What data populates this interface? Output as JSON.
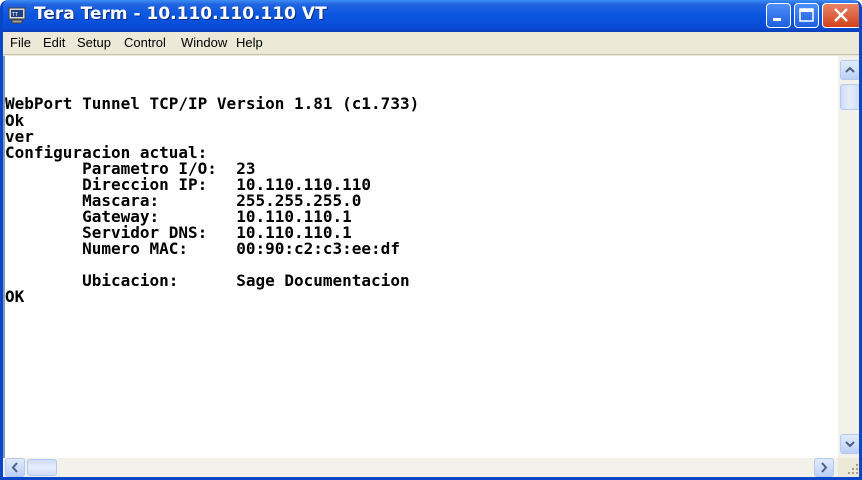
{
  "window": {
    "title": "Tera Term - 10.110.110.110 VT",
    "colors": {
      "titlebar": "#0a55e0",
      "close": "#d2431d",
      "terminal_bg": "#ffffff",
      "terminal_fg": "#000000"
    }
  },
  "menu": {
    "items": [
      "File",
      "Edit",
      "Setup",
      "Control",
      "Window",
      "Help"
    ]
  },
  "terminal": {
    "lines": [
      "WebPort Tunnel TCP/IP Version 1.81 (c1.733)",
      "Ok",
      "ver",
      "Configuracion actual:",
      "        Parametro I/O:  23",
      "        Direccion IP:   10.110.110.110",
      "        Mascara:        255.255.255.0",
      "        Gateway:        10.110.110.1",
      "        Servidor DNS:   10.110.110.1",
      "        Numero MAC:     00:90:c2:c3:ee:df",
      "",
      "        Ubicacion:      Sage Documentacion",
      "OK"
    ]
  },
  "icons": {
    "app": "teraterm-app-icon",
    "minimize": "minimize-icon",
    "maximize": "maximize-icon",
    "close": "close-icon",
    "scroll_up": "arrow-up-icon",
    "scroll_down": "arrow-down-icon",
    "scroll_left": "arrow-left-icon",
    "scroll_right": "arrow-right-icon"
  }
}
